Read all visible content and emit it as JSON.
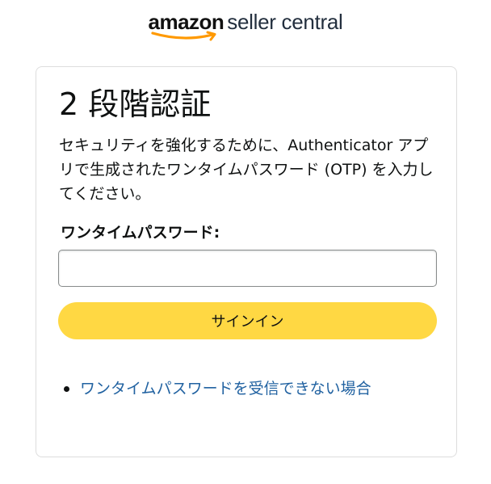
{
  "logo": {
    "brand": "amazon",
    "product": "seller central"
  },
  "card": {
    "title": "2 段階認証",
    "description": "セキュリティを強化するために、Authenticator アプリで生成されたワンタイムパスワード (OTP) を入力してください。",
    "otp_label": "ワンタイムパスワード:",
    "otp_value": "",
    "signin_label": "サインイン",
    "help_links": [
      {
        "label": "ワンタイムパスワードを受信できない場合"
      }
    ]
  },
  "colors": {
    "button": "#ffd843",
    "link": "#2162a1",
    "border": "#dddddd",
    "logo_smile": "#ff9900"
  }
}
